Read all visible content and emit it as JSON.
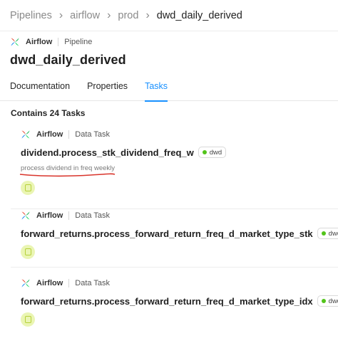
{
  "breadcrumb": {
    "items": [
      "Pipelines",
      "airflow",
      "prod",
      "dwd_daily_derived"
    ],
    "separator": "›"
  },
  "pipeline": {
    "service": "Airflow",
    "kind": "Pipeline",
    "title": "dwd_daily_derived"
  },
  "tabs": [
    {
      "label": "Documentation",
      "active": false
    },
    {
      "label": "Properties",
      "active": false
    },
    {
      "label": "Tasks",
      "active": true
    }
  ],
  "tasks_section": {
    "heading": "Contains 24 Tasks",
    "tasks": [
      {
        "service": "Airflow",
        "kind": "Data Task",
        "name": "dividend.process_stk_dividend_freq_w",
        "tag": "dwd",
        "description": "process dividend in freq weekly"
      },
      {
        "service": "Airflow",
        "kind": "Data Task",
        "name": "forward_returns.process_forward_return_freq_d_market_type_stk",
        "tag": "dwd",
        "description": ""
      },
      {
        "service": "Airflow",
        "kind": "Data Task",
        "name": "forward_returns.process_forward_return_freq_d_market_type_idx",
        "tag": "dwd",
        "description": ""
      }
    ]
  },
  "colors": {
    "accent": "#1890ff",
    "tag_dot": "#52c41a",
    "annotation_underline": "#d9342b",
    "task_icon_bg": "#eaf5b3"
  },
  "icons": {
    "service_logo": "airflow-logo-icon",
    "task_type": "task-type-icon"
  }
}
